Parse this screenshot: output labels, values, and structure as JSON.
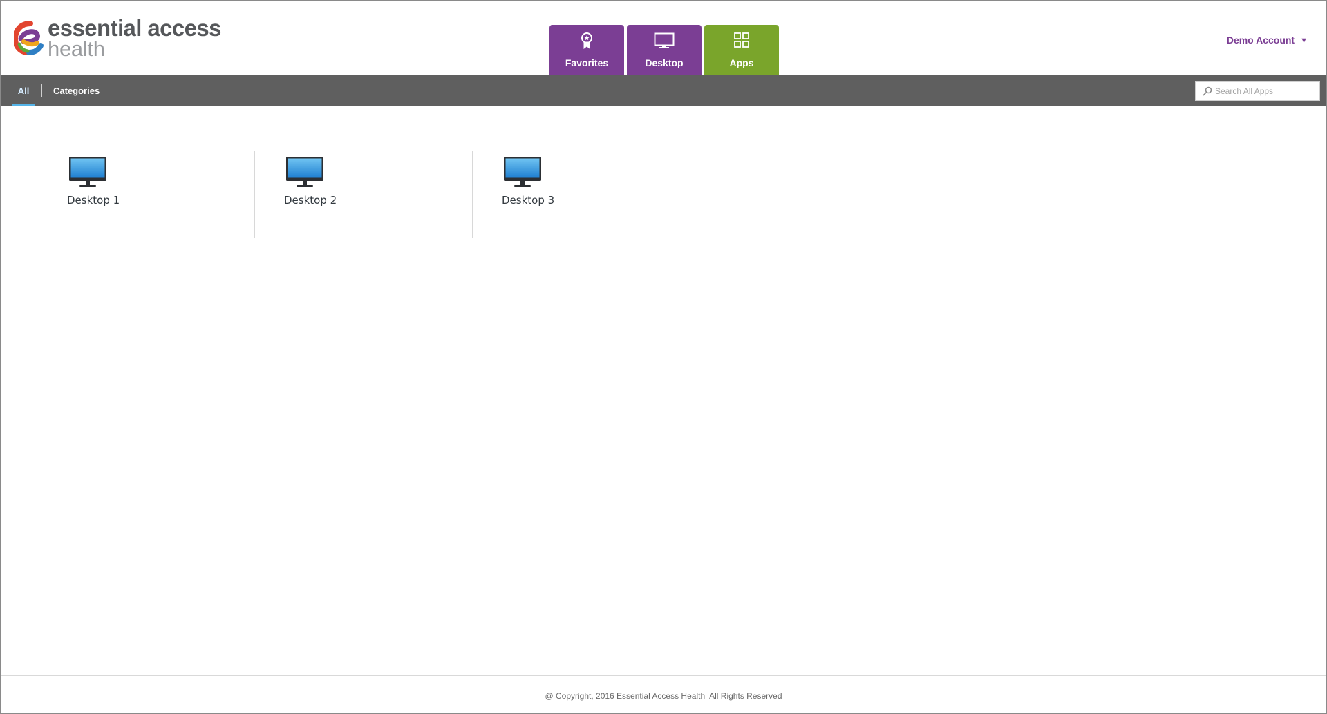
{
  "brand": {
    "name_line1": "essential access",
    "name_line2": "health",
    "colors": {
      "purple": "#7b3e94",
      "green": "#7aa52b",
      "toolbar": "#5f5f5f",
      "accent_blue": "#55b4e8"
    }
  },
  "header": {
    "tabs": [
      {
        "label": "Favorites",
        "icon": "award-ribbon-icon",
        "color": "#7b3e94",
        "active": false
      },
      {
        "label": "Desktop",
        "icon": "monitor-icon",
        "color": "#7b3e94",
        "active": false
      },
      {
        "label": "Apps",
        "icon": "grid-apps-icon",
        "color": "#7aa52b",
        "active": true
      }
    ],
    "account": {
      "label": "Demo Account",
      "caret": "▼"
    }
  },
  "toolbar": {
    "filters": [
      {
        "label": "All",
        "active": true
      },
      {
        "label": "Categories",
        "active": false
      }
    ],
    "search": {
      "placeholder": "Search All Apps",
      "value": "",
      "icon": "search-icon"
    }
  },
  "apps": [
    {
      "label": "Desktop 1",
      "icon": "desktop-monitor-icon"
    },
    {
      "label": "Desktop 2",
      "icon": "desktop-monitor-icon"
    },
    {
      "label": "Desktop 3",
      "icon": "desktop-monitor-icon"
    }
  ],
  "footer": {
    "copyright": "@ Copyright, 2016 Essential Access Health  All Rights Reserved"
  }
}
